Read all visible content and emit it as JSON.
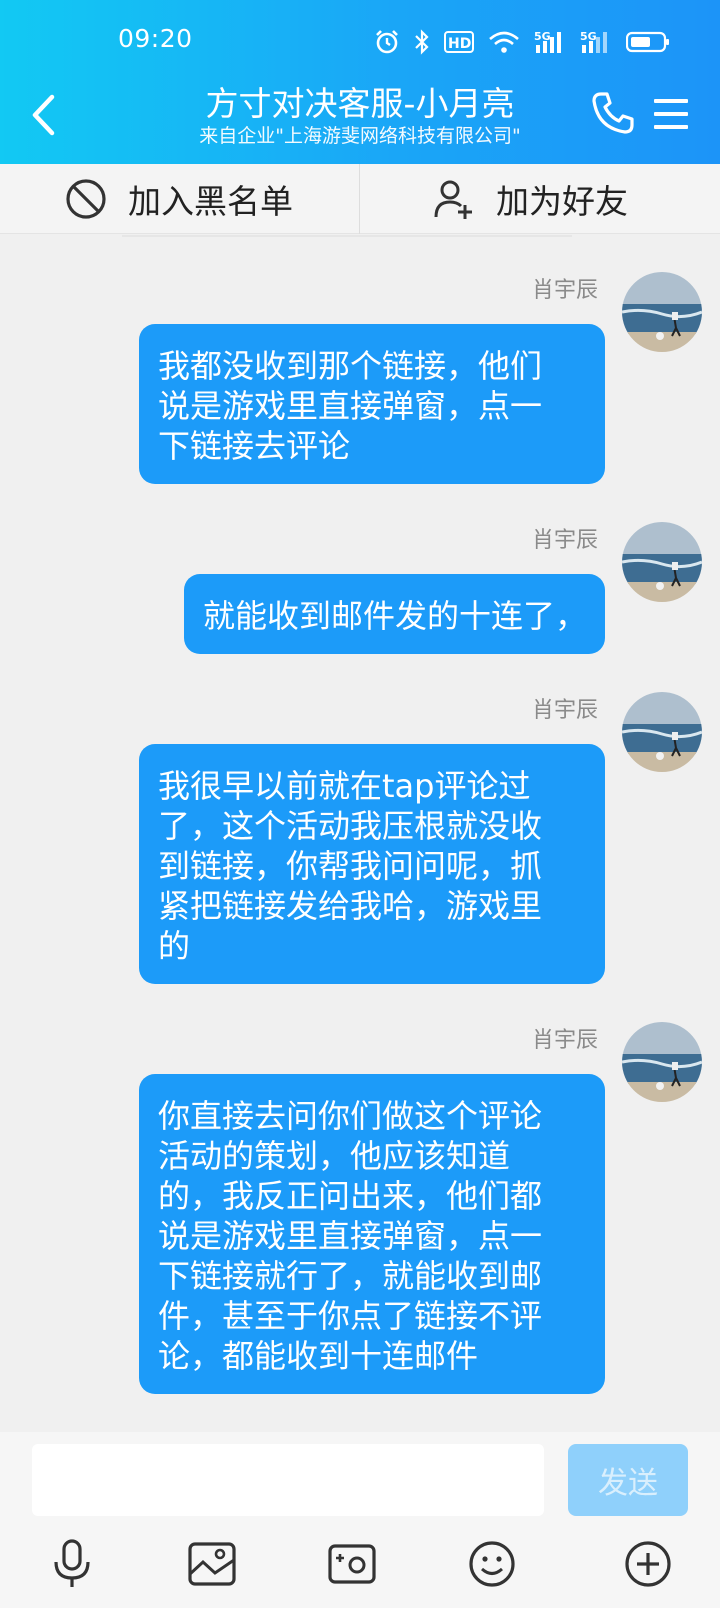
{
  "status_bar": {
    "time": "09:20",
    "hd_label": "HD",
    "network_1": "5G",
    "network_2": "5G"
  },
  "header": {
    "title": "方寸对决客服-小月亮",
    "subtitle": "来自企业\"上海游斐网络科技有限公司\""
  },
  "actions": {
    "block_label": "加入黑名单",
    "add_friend_label": "加为好友"
  },
  "messages": [
    {
      "sender": "肖宇辰",
      "lines": [
        "我都没收到那个链接，他们",
        "说是游戏里直接弹窗，点一",
        "下链接去评论"
      ]
    },
    {
      "sender": "肖宇辰",
      "lines": [
        "就能收到邮件发的十连了，"
      ]
    },
    {
      "sender": "肖宇辰",
      "lines": [
        "我很早以前就在tap评论过",
        "了，这个活动我压根就没收",
        "到链接，你帮我问问呢，抓",
        "紧把链接发给我哈，游戏里",
        "的"
      ]
    },
    {
      "sender": "肖宇辰",
      "lines": [
        "你直接去问你们做这个评论",
        "活动的策划，他应该知道",
        "的，我反正问出来，他们都",
        "说是游戏里直接弹窗，点一",
        "下链接就行了，就能收到邮",
        "件，甚至于你点了链接不评",
        "论，都能收到十连邮件"
      ]
    }
  ],
  "input": {
    "value": "",
    "send_label": "发送"
  },
  "colors": {
    "header_start": "#12c9f3",
    "header_end": "#1c94f8",
    "bubble": "#1c9bf9",
    "send_disabled": "#8fd0fb"
  },
  "icons": {
    "toolbar": [
      "microphone-icon",
      "image-icon",
      "camera-icon",
      "emoji-icon",
      "plus-icon"
    ]
  }
}
